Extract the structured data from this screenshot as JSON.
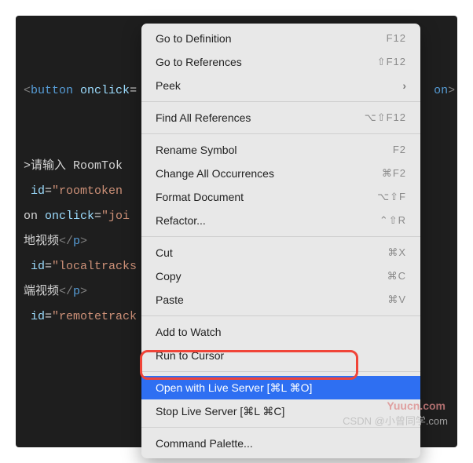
{
  "code": {
    "l1_tag_open": "<",
    "l1_tag": "button",
    "l1_attr": "onclick",
    "l1_eq": "=",
    "l1_tail": "on",
    "l1_close": ">",
    "l2_text": ">请输入 RoomTok",
    "l3_pre": " ",
    "l3_attr": "id",
    "l3_eq": "=",
    "l3_val": "\"roomtoken",
    "l4_pre": "on ",
    "l4_attr": "onclick",
    "l4_eq": "=",
    "l4_val": "\"joi",
    "l5_text": "地视频",
    "l5_close_open": "</",
    "l5_close_tag": "p",
    "l5_close_end": ">",
    "l6_attr": " id",
    "l6_eq": "=",
    "l6_val": "\"localtracks",
    "l7_text": "端视频",
    "l7_close_open": "</",
    "l7_close_tag": "p",
    "l7_close_end": ">",
    "l8_attr": " id",
    "l8_eq": "=",
    "l8_val": "\"remotetrack"
  },
  "menu": {
    "go_to_definition": "Go to Definition",
    "go_to_definition_sc": "F12",
    "go_to_references": "Go to References",
    "go_to_references_sc": "⇧F12",
    "peek": "Peek",
    "find_all_references": "Find All References",
    "find_all_references_sc": "⌥⇧F12",
    "rename_symbol": "Rename Symbol",
    "rename_symbol_sc": "F2",
    "change_all_occurrences": "Change All Occurrences",
    "change_all_occurrences_sc": "⌘F2",
    "format_document": "Format Document",
    "format_document_sc": "⌥⇧F",
    "refactor": "Refactor...",
    "refactor_sc": "⌃⇧R",
    "cut": "Cut",
    "cut_sc": "⌘X",
    "copy": "Copy",
    "copy_sc": "⌘C",
    "paste": "Paste",
    "paste_sc": "⌘V",
    "add_to_watch": "Add to Watch",
    "run_to_cursor": "Run to Cursor",
    "open_live_server": "Open with Live Server [⌘L ⌘O]",
    "stop_live_server": "Stop Live Server [⌘L ⌘C]",
    "command_palette": "Command Palette..."
  },
  "watermark": {
    "w1": "Yuucn.com",
    "w2": "CSDN @小曾同学.com"
  }
}
